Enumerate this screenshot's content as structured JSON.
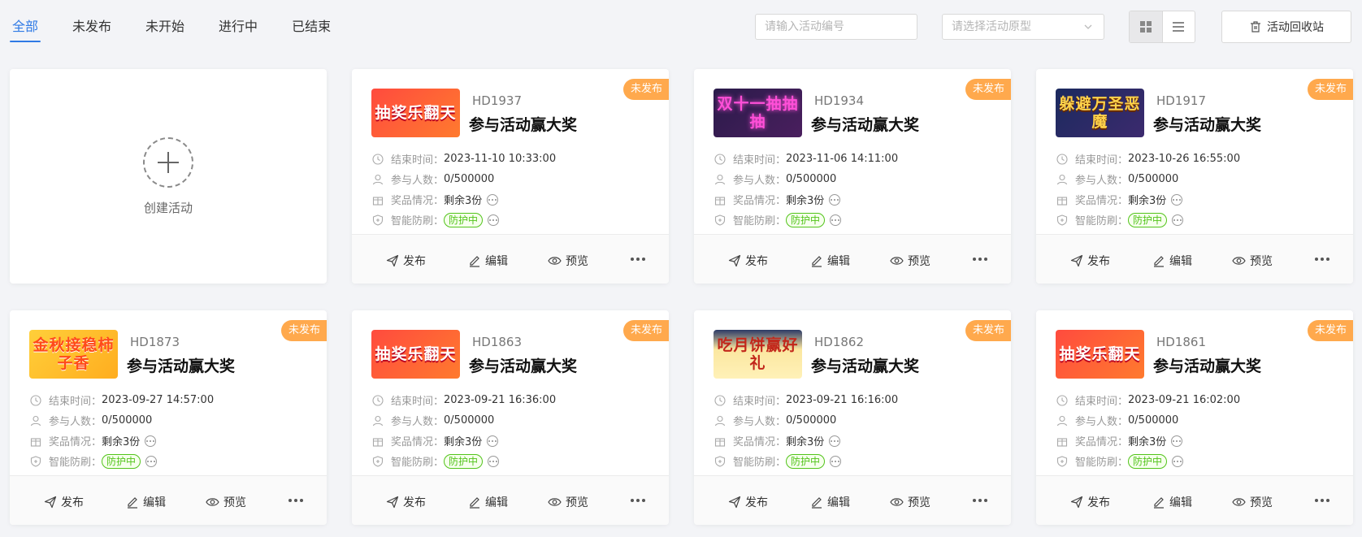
{
  "tabs": [
    {
      "label": "全部",
      "active": true
    },
    {
      "label": "未发布",
      "active": false
    },
    {
      "label": "未开始",
      "active": false
    },
    {
      "label": "进行中",
      "active": false
    },
    {
      "label": "已结束",
      "active": false
    }
  ],
  "search": {
    "placeholder": "请输入活动编号"
  },
  "prototype_select": {
    "placeholder": "请选择活动原型"
  },
  "recycle_bin_label": "活动回收站",
  "create_label": "创建活动",
  "labels": {
    "end_time": "结束时间：",
    "participants": "参与人数：",
    "prizes": "奖品情况：",
    "anti_fraud": "智能防刷："
  },
  "actions": {
    "publish": "发布",
    "edit": "编辑",
    "preview": "预览"
  },
  "cards": [
    {
      "code": "HD1937",
      "title": "参与活动赢大奖",
      "status": "未发布",
      "end_time": "2023-11-10 10:33:00",
      "participants": "0/500000",
      "prizes": "剩余3份",
      "guard": "防护中",
      "thumb_text": "抽奖乐翻天",
      "thumb_theme": "red"
    },
    {
      "code": "HD1934",
      "title": "参与活动赢大奖",
      "status": "未发布",
      "end_time": "2023-11-06 14:11:00",
      "participants": "0/500000",
      "prizes": "剩余3份",
      "guard": "防护中",
      "thumb_text": "双十一抽抽抽",
      "thumb_theme": "neon"
    },
    {
      "code": "HD1917",
      "title": "参与活动赢大奖",
      "status": "未发布",
      "end_time": "2023-10-26 16:55:00",
      "participants": "0/500000",
      "prizes": "剩余3份",
      "guard": "防护中",
      "thumb_text": "躲避万圣恶魔",
      "thumb_theme": "night"
    },
    {
      "code": "HD1873",
      "title": "参与活动赢大奖",
      "status": "未发布",
      "end_time": "2023-09-27 14:57:00",
      "participants": "0/500000",
      "prizes": "剩余3份",
      "guard": "防护中",
      "thumb_text": "金秋接稳柿子香",
      "thumb_theme": "autumn"
    },
    {
      "code": "HD1863",
      "title": "参与活动赢大奖",
      "status": "未发布",
      "end_time": "2023-09-21 16:36:00",
      "participants": "0/500000",
      "prizes": "剩余3份",
      "guard": "防护中",
      "thumb_text": "抽奖乐翻天",
      "thumb_theme": "red"
    },
    {
      "code": "HD1862",
      "title": "参与活动赢大奖",
      "status": "未发布",
      "end_time": "2023-09-21 16:16:00",
      "participants": "0/500000",
      "prizes": "剩余3份",
      "guard": "防护中",
      "thumb_text": "吃月饼赢好礼",
      "thumb_theme": "moon"
    },
    {
      "code": "HD1861",
      "title": "参与活动赢大奖",
      "status": "未发布",
      "end_time": "2023-09-21 16:02:00",
      "participants": "0/500000",
      "prizes": "剩余3份",
      "guard": "防护中",
      "thumb_text": "抽奖乐翻天",
      "thumb_theme": "red"
    }
  ],
  "colors": {
    "accent": "#2f7ae5",
    "badge": "#ffa94d",
    "guard": "#52c41a"
  }
}
